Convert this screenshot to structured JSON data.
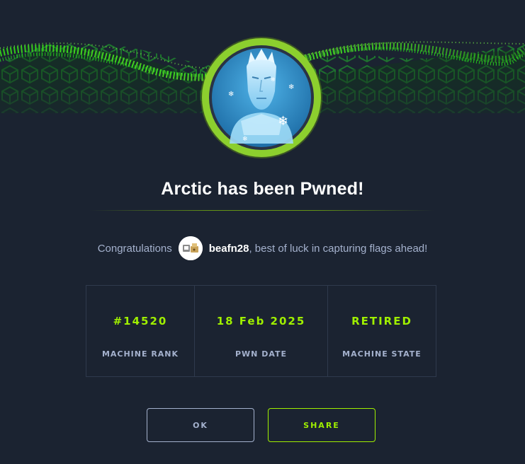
{
  "dialog": {
    "title": "Arctic has been Pwned!",
    "congrats_prefix": "Congratulations",
    "username": "beafn28",
    "congrats_suffix": ", best of luck in capturing flags ahead!"
  },
  "stats": [
    {
      "value": "#14520",
      "label": "MACHINE RANK"
    },
    {
      "value": "18 Feb 2025",
      "label": "PWN DATE"
    },
    {
      "value": "RETIRED",
      "label": "MACHINE STATE"
    }
  ],
  "buttons": {
    "ok": "OK",
    "share": "SHARE"
  },
  "colors": {
    "background": "#1b2331",
    "accent": "#9fef00",
    "muted_text": "#a4b1cd",
    "border": "#2f3a4d"
  },
  "icons": {
    "banner": "green-hex-grid-wave",
    "machine_avatar": "ice-king-icon",
    "user_avatar": "user-avatar-icon"
  }
}
